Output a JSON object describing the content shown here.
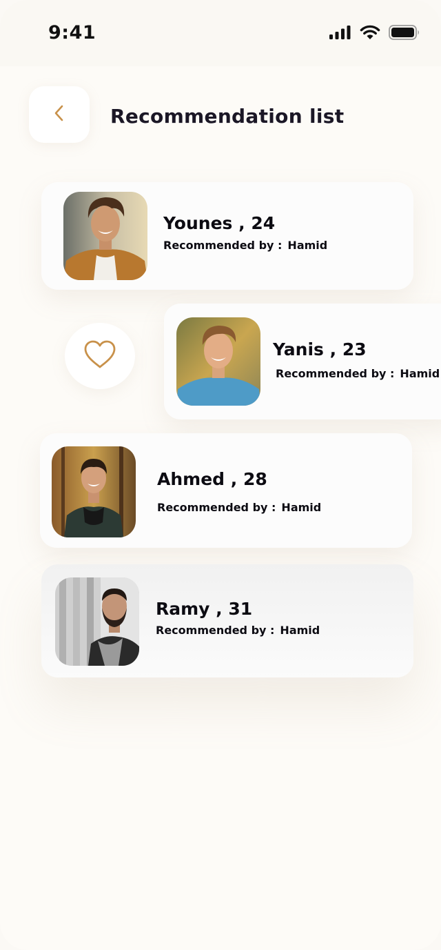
{
  "status_bar": {
    "time": "9:41",
    "icons": [
      "signal-icon",
      "wifi-icon",
      "battery-icon"
    ]
  },
  "header": {
    "back_icon": "chevron-left-icon",
    "title": "Recommendation list"
  },
  "recommendations": [
    {
      "name": "Younes , 24",
      "recommended_label": "Recommended by :",
      "recommender": "Hamid"
    },
    {
      "name": "Yanis , 23",
      "recommended_label": "Recommended by :",
      "recommender": "Hamid"
    },
    {
      "name": "Ahmed , 28",
      "recommended_label": "Recommended by :",
      "recommender": "Hamid"
    },
    {
      "name": "Ramy , 31",
      "recommended_label": "Recommended by :",
      "recommender": "Hamid"
    }
  ],
  "swipe_action": {
    "icon": "heart-icon"
  },
  "colors": {
    "accent": "#c8914a",
    "background": "#fdfbf7",
    "card": "#fcfcfc",
    "text": "#0c0b12"
  }
}
